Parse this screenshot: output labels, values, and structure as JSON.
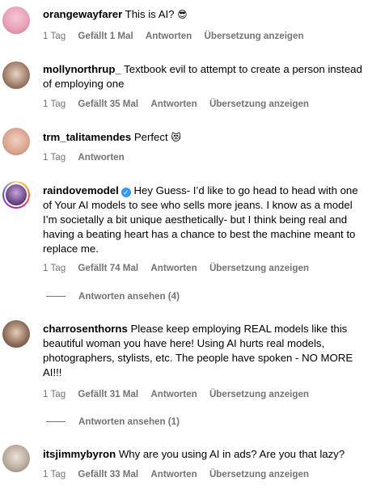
{
  "comments": [
    {
      "username": "orangewayfarer",
      "text": "This is AI?",
      "emoji": "😎",
      "time": "1 Tag",
      "likes": "Gefällt 1 Mal",
      "reply": "Antworten",
      "translate": "Übersetzung anzeigen"
    },
    {
      "username": "mollynorthrup_",
      "text": "Textbook evil to attempt to create a person instead of employing one",
      "time": "1 Tag",
      "likes": "Gefällt 35 Mal",
      "reply": "Antworten",
      "translate": "Übersetzung anzeigen"
    },
    {
      "username": "trm_talitamendes",
      "text": "Perfect",
      "emoji": "😻",
      "time": "1 Tag",
      "reply": "Antworten"
    },
    {
      "username": "raindovemodel",
      "verified_mark": "✓",
      "text": "Hey Guess- I’d like to go head to head with one of Your AI models to see who sells more jeans. I know as a model I’m societally a bit unique aesthetically- but I think being real and having a beating heart has a chance to best the machine meant to replace me.",
      "time": "1 Tag",
      "likes": "Gefällt 74 Mal",
      "reply": "Antworten",
      "translate": "Übersetzung anzeigen",
      "view_replies": "Antworten ansehen (4)"
    },
    {
      "username": "charrosenthorns",
      "text": "Please keep employing REAL models like this beautiful woman you have here! Using AI hurts real models, photographers, stylists, etc. The people have spoken - NO MORE AI!!!",
      "time": "1 Tag",
      "likes": "Gefällt 31 Mal",
      "reply": "Antworten",
      "translate": "Übersetzung anzeigen",
      "view_replies": "Antworten ansehen (1)"
    },
    {
      "username": "itsjimmybyron",
      "text": "Why are you using AI in ads? Are you that lazy?",
      "time": "1 Tag",
      "likes": "Gefällt 33 Mal",
      "reply": "Antworten",
      "translate": "Übersetzung anzeigen"
    }
  ],
  "colors": {
    "meta_text": "#737373",
    "verified_badge": "#3897f0",
    "avatar_1": "#e8a2b8",
    "avatar_2": "#9c7a66",
    "avatar_3": "#d9a48f",
    "avatar_4": "#6d4a8a",
    "avatar_5": "#8a6b57",
    "avatar_6": "#b8a89a"
  }
}
